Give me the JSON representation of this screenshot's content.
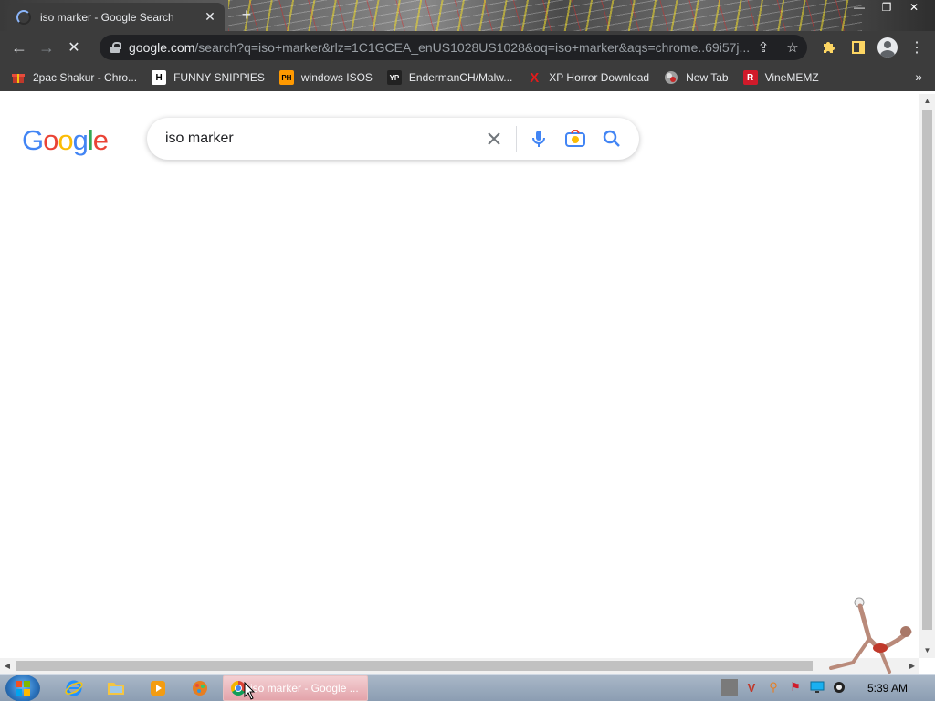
{
  "window": {
    "tab_title": "iso marker - Google Search",
    "tab_close": "✕",
    "new_tab": "+",
    "minimize": "—",
    "maximize": "❐",
    "close": "✕"
  },
  "toolbar": {
    "back": "←",
    "forward": "→",
    "reload": "✕",
    "url_host": "google.com",
    "url_path": "/search?q=iso+marker&rlz=1C1GCEA_enUS1028US1028&oq=iso+marker&aqs=chrome..69i57j...",
    "share": "⇪",
    "star": "☆",
    "menu": "⋮"
  },
  "bookmarks": {
    "items": [
      {
        "label": "2pac Shakur - Chro...",
        "icon": "gift-icon",
        "color": "#ffffff"
      },
      {
        "label": "FUNNY SNIPPIES",
        "icon": "H",
        "color": "#ffffff"
      },
      {
        "label": "windows ISOS",
        "icon": "PH",
        "color": "#ff9900"
      },
      {
        "label": "EndermanCH/Malw...",
        "icon": "YP",
        "color": "#222222"
      },
      {
        "label": "XP Horror Download",
        "icon": "X",
        "color": "#e21b1b"
      },
      {
        "label": "New Tab",
        "icon": "globe-icon",
        "color": "#cccccc"
      },
      {
        "label": "VineMEMZ",
        "icon": "R",
        "color": "#d11a2a"
      }
    ],
    "more": "»"
  },
  "search": {
    "logo": [
      "G",
      "o",
      "o",
      "g",
      "l",
      "e"
    ],
    "logo_colors": [
      "#4285f4",
      "#ea4335",
      "#fbbc05",
      "#4285f4",
      "#34a853",
      "#ea4335"
    ],
    "query": "iso marker"
  },
  "taskbar": {
    "chrome_task_label": "iso marker - Google ...",
    "clock": "5:39 AM"
  }
}
